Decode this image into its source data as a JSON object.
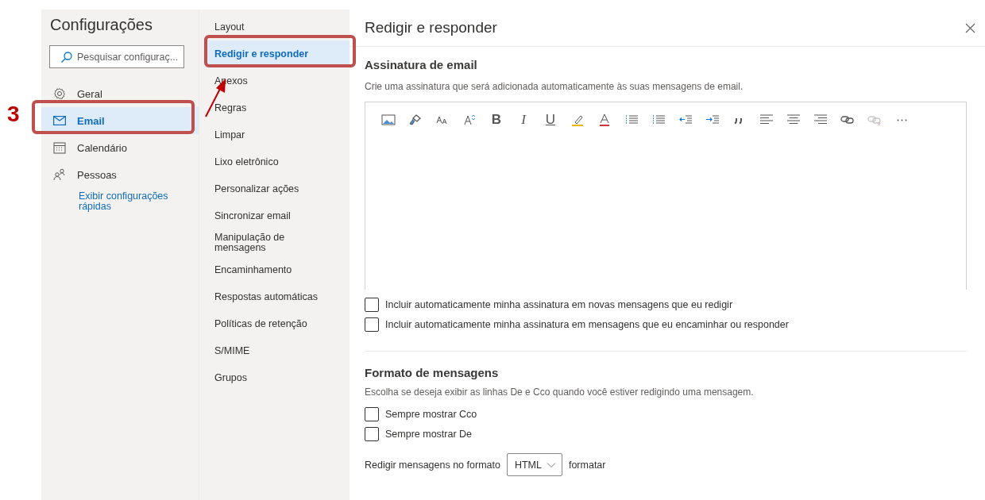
{
  "settings_nav": {
    "title": "Configurações",
    "search": {
      "placeholder": "Pesquisar configuraç..."
    },
    "items": [
      {
        "label": "Geral",
        "kind": "gear",
        "selected": false,
        "highlighted": false
      },
      {
        "label": "Email",
        "kind": "mail",
        "selected": true,
        "highlighted": true
      },
      {
        "label": "Calendário",
        "kind": "calendar",
        "selected": false,
        "highlighted": false
      },
      {
        "label": "Pessoas",
        "kind": "people",
        "selected": false,
        "highlighted": false
      }
    ],
    "quick_settings_link": "Exibir configurações rápidas"
  },
  "email_nav": {
    "items": [
      {
        "label": "Layout",
        "selected": false,
        "highlighted": false
      },
      {
        "label": "Redigir e responder",
        "selected": true,
        "highlighted": true
      },
      {
        "label": "Anexos",
        "selected": false,
        "highlighted": false
      },
      {
        "label": "Regras",
        "selected": false,
        "highlighted": false
      },
      {
        "label": "Limpar",
        "selected": false,
        "highlighted": false
      },
      {
        "label": "Lixo eletrônico",
        "selected": false,
        "highlighted": false
      },
      {
        "label": "Personalizar ações",
        "selected": false,
        "highlighted": false
      },
      {
        "label": "Sincronizar email",
        "selected": false,
        "highlighted": false
      },
      {
        "label": "Manipulação de mensagens",
        "selected": false,
        "highlighted": false
      },
      {
        "label": "Encaminhamento",
        "selected": false,
        "highlighted": false
      },
      {
        "label": "Respostas automáticas",
        "selected": false,
        "highlighted": false
      },
      {
        "label": "Políticas de retenção",
        "selected": false,
        "highlighted": false
      },
      {
        "label": "S/MIME",
        "selected": false,
        "highlighted": false
      },
      {
        "label": "Grupos",
        "selected": false,
        "highlighted": false
      }
    ]
  },
  "panel": {
    "title": "Redigir e responder",
    "signature": {
      "heading": "Assinatura de email",
      "description": "Crie uma assinatura que será adicionada automaticamente às suas mensagens de email.",
      "toolbar": [
        {
          "kind": "image",
          "disabled": false
        },
        {
          "kind": "painter",
          "disabled": false
        },
        {
          "kind": "fontsize",
          "disabled": false
        },
        {
          "kind": "grow",
          "disabled": false
        },
        {
          "kind": "bold",
          "label": "B",
          "disabled": false
        },
        {
          "kind": "italic",
          "label": "I",
          "disabled": false
        },
        {
          "kind": "underline",
          "label": "U",
          "disabled": false
        },
        {
          "kind": "highlight",
          "disabled": false
        },
        {
          "kind": "fontcolor",
          "disabled": false
        },
        {
          "kind": "bullets",
          "disabled": false
        },
        {
          "kind": "numbering",
          "disabled": false
        },
        {
          "kind": "outdent",
          "disabled": false
        },
        {
          "kind": "indent",
          "disabled": false
        },
        {
          "kind": "quote",
          "disabled": false
        },
        {
          "kind": "left",
          "disabled": false
        },
        {
          "kind": "center",
          "disabled": false
        },
        {
          "kind": "right",
          "disabled": false
        },
        {
          "kind": "link",
          "disabled": false
        },
        {
          "kind": "unlink",
          "disabled": true
        },
        {
          "kind": "more",
          "disabled": false
        }
      ],
      "options": [
        {
          "label": "Incluir automaticamente minha assinatura em novas mensagens que eu redigir",
          "checked": false
        },
        {
          "label": "Incluir automaticamente minha assinatura em mensagens que eu encaminhar ou responder",
          "checked": false
        }
      ]
    },
    "format": {
      "heading": "Formato de mensagens",
      "description": "Escolha se deseja exibir as linhas De e Cco quando você estiver redigindo uma mensagem.",
      "options": [
        {
          "label": "Sempre mostrar Cco",
          "checked": false
        },
        {
          "label": "Sempre mostrar De",
          "checked": false
        }
      ],
      "compose_label": "Redigir mensagens no formato",
      "compose_value": "HTML",
      "compose_suffix": "formatar"
    }
  },
  "annotation": {
    "step_number": "3"
  }
}
